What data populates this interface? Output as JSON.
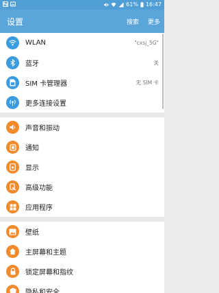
{
  "statusbar": {
    "left_icons": [
      "n-icon",
      "image-icon"
    ],
    "battery": "61%",
    "time": "16:47"
  },
  "appbar": {
    "title": "设置",
    "search": "搜索",
    "more": "更多"
  },
  "sections": [
    {
      "items": [
        {
          "label": "WLAN",
          "value": "\"cxsj_5G\"",
          "icon": "wifi-icon",
          "color": "#3b9de0"
        },
        {
          "label": "蓝牙",
          "value": "关",
          "icon": "bluetooth-icon",
          "color": "#3b9de0"
        },
        {
          "label": "SIM 卡管理器",
          "value": "无 SIM 卡",
          "icon": "sim-card-icon",
          "color": "#3b9de0"
        },
        {
          "label": "更多连接设置",
          "value": "",
          "icon": "connections-icon",
          "color": "#3b9de0"
        }
      ]
    },
    {
      "items": [
        {
          "label": "声音和振动",
          "value": "",
          "icon": "sound-icon",
          "color": "#f08a2a"
        },
        {
          "label": "通知",
          "value": "",
          "icon": "notification-icon",
          "color": "#f08a2a"
        },
        {
          "label": "显示",
          "value": "",
          "icon": "display-icon",
          "color": "#f08a2a"
        },
        {
          "label": "高级功能",
          "value": "",
          "icon": "advanced-features-icon",
          "color": "#f08a2a"
        },
        {
          "label": "应用程序",
          "value": "",
          "icon": "apps-icon",
          "color": "#f08a2a"
        }
      ]
    },
    {
      "items": [
        {
          "label": "壁纸",
          "value": "",
          "icon": "wallpaper-icon",
          "color": "#f08a2a"
        },
        {
          "label": "主屏幕和主题",
          "value": "",
          "icon": "home-theme-icon",
          "color": "#f08a2a"
        },
        {
          "label": "锁定屏幕和指纹",
          "value": "",
          "icon": "lock-screen-icon",
          "color": "#f08a2a"
        },
        {
          "label": "隐私和安全",
          "value": "",
          "icon": "privacy-icon",
          "color": "#f08a2a"
        }
      ]
    }
  ]
}
